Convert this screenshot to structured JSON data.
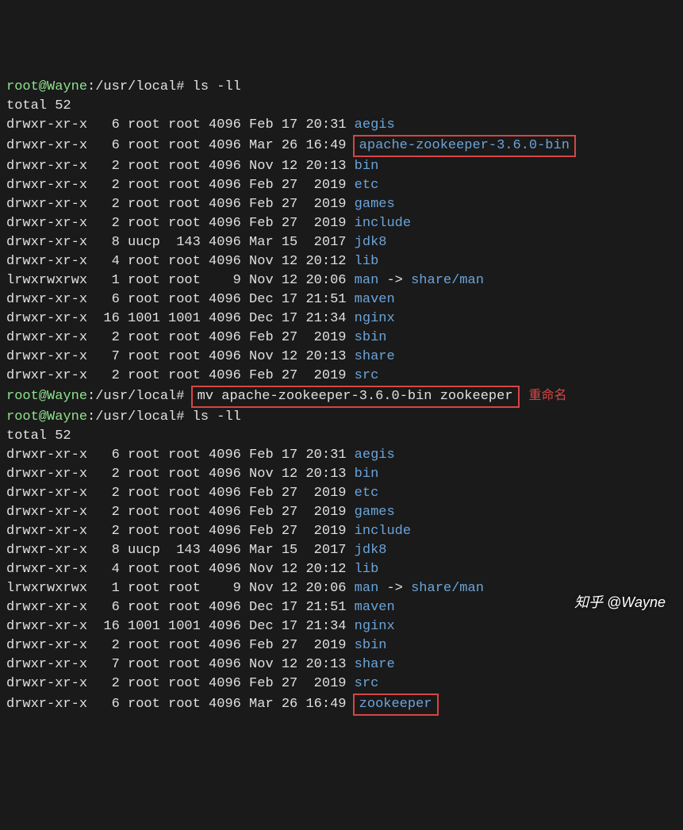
{
  "prompt1": {
    "user_host": "root@Wayne",
    "path": ":/usr/local#",
    "cmd": " ls -ll"
  },
  "total": "total 52",
  "listing1": [
    {
      "perm": "drwxr-xr-x   6 root root 4096 Feb 17 20:31 ",
      "name": "aegis"
    },
    {
      "perm": "drwxr-xr-x   6 root root 4096 Mar 26 16:49 ",
      "name": "apache-zookeeper-3.6.0-bin",
      "boxed": true
    },
    {
      "perm": "drwxr-xr-x   2 root root 4096 Nov 12 20:13 ",
      "name": "bin"
    },
    {
      "perm": "drwxr-xr-x   2 root root 4096 Feb 27  2019 ",
      "name": "etc"
    },
    {
      "perm": "drwxr-xr-x   2 root root 4096 Feb 27  2019 ",
      "name": "games"
    },
    {
      "perm": "drwxr-xr-x   2 root root 4096 Feb 27  2019 ",
      "name": "include"
    },
    {
      "perm": "drwxr-xr-x   8 uucp  143 4096 Mar 15  2017 ",
      "name": "jdk8"
    },
    {
      "perm": "drwxr-xr-x   4 root root 4096 Nov 12 20:12 ",
      "name": "lib"
    },
    {
      "perm": "lrwxrwxrwx   1 root root    9 Nov 12 20:06 ",
      "name": "man",
      "link": "share/man"
    },
    {
      "perm": "drwxr-xr-x   6 root root 4096 Dec 17 21:51 ",
      "name": "maven"
    },
    {
      "perm": "drwxr-xr-x  16 1001 1001 4096 Dec 17 21:34 ",
      "name": "nginx"
    },
    {
      "perm": "drwxr-xr-x   2 root root 4096 Feb 27  2019 ",
      "name": "sbin"
    },
    {
      "perm": "drwxr-xr-x   7 root root 4096 Nov 12 20:13 ",
      "name": "share"
    },
    {
      "perm": "drwxr-xr-x   2 root root 4096 Feb 27  2019 ",
      "name": "src"
    }
  ],
  "prompt2": {
    "user_host": "root@Wayne",
    "path": ":/usr/local#",
    "cmd": "mv apache-zookeeper-3.6.0-bin zookeeper",
    "annotation": "重命名"
  },
  "prompt3": {
    "user_host": "root@Wayne",
    "path": ":/usr/local#",
    "cmd": " ls -ll"
  },
  "total2": "total 52",
  "listing2": [
    {
      "perm": "drwxr-xr-x   6 root root 4096 Feb 17 20:31 ",
      "name": "aegis"
    },
    {
      "perm": "drwxr-xr-x   2 root root 4096 Nov 12 20:13 ",
      "name": "bin"
    },
    {
      "perm": "drwxr-xr-x   2 root root 4096 Feb 27  2019 ",
      "name": "etc"
    },
    {
      "perm": "drwxr-xr-x   2 root root 4096 Feb 27  2019 ",
      "name": "games"
    },
    {
      "perm": "drwxr-xr-x   2 root root 4096 Feb 27  2019 ",
      "name": "include"
    },
    {
      "perm": "drwxr-xr-x   8 uucp  143 4096 Mar 15  2017 ",
      "name": "jdk8"
    },
    {
      "perm": "drwxr-xr-x   4 root root 4096 Nov 12 20:12 ",
      "name": "lib"
    },
    {
      "perm": "lrwxrwxrwx   1 root root    9 Nov 12 20:06 ",
      "name": "man",
      "link": "share/man"
    },
    {
      "perm": "drwxr-xr-x   6 root root 4096 Dec 17 21:51 ",
      "name": "maven"
    },
    {
      "perm": "drwxr-xr-x  16 1001 1001 4096 Dec 17 21:34 ",
      "name": "nginx"
    },
    {
      "perm": "drwxr-xr-x   2 root root 4096 Feb 27  2019 ",
      "name": "sbin"
    },
    {
      "perm": "drwxr-xr-x   7 root root 4096 Nov 12 20:13 ",
      "name": "share"
    },
    {
      "perm": "drwxr-xr-x   2 root root 4096 Feb 27  2019 ",
      "name": "src"
    },
    {
      "perm": "drwxr-xr-x   6 root root 4096 Mar 26 16:49 ",
      "name": "zookeeper",
      "boxed": true
    }
  ],
  "watermark": "知乎 @Wayne"
}
